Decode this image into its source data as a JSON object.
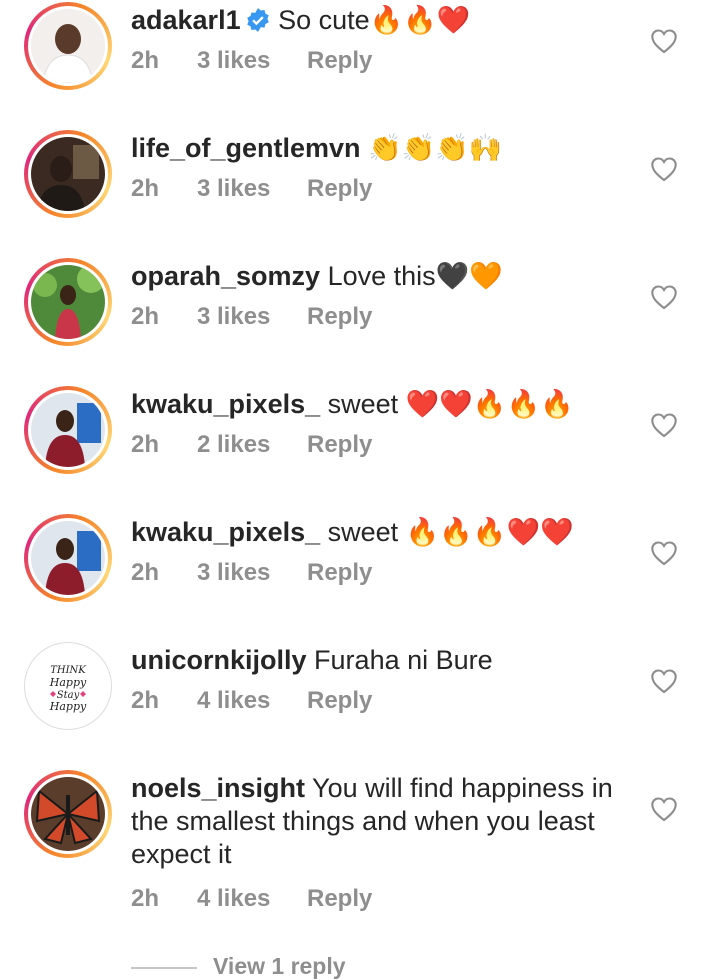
{
  "comments": [
    {
      "username": "adakarl1",
      "verified": true,
      "text": "So cute🔥🔥❤️",
      "time": "2h",
      "likes": "3 likes",
      "reply": "Reply"
    },
    {
      "username": "life_of_gentlemvn",
      "verified": false,
      "text": "👏👏👏🙌",
      "time": "2h",
      "likes": "3 likes",
      "reply": "Reply"
    },
    {
      "username": "oparah_somzy",
      "verified": false,
      "text": "Love this🖤🧡",
      "time": "2h",
      "likes": "3 likes",
      "reply": "Reply"
    },
    {
      "username": "kwaku_pixels_",
      "verified": false,
      "text": "sweet ❤️❤️🔥🔥🔥",
      "time": "2h",
      "likes": "2 likes",
      "reply": "Reply"
    },
    {
      "username": "kwaku_pixels_",
      "verified": false,
      "text": "sweet 🔥🔥🔥❤️❤️",
      "time": "2h",
      "likes": "3 likes",
      "reply": "Reply"
    },
    {
      "username": "unicornkijolly",
      "verified": false,
      "text": "Furaha  ni Bure",
      "time": "2h",
      "likes": "4 likes",
      "reply": "Reply",
      "avatar_text": [
        "THINK",
        "Happy",
        "Stay",
        "Happy"
      ]
    },
    {
      "username": "noels_insight",
      "verified": false,
      "text": "You will find happiness in the smallest things and when you least expect it",
      "time": "2h",
      "likes": "4 likes",
      "reply": "Reply"
    }
  ],
  "view_replies": "View 1 reply",
  "icons": {
    "like": "heart-outline-icon",
    "verified": "verified-badge-icon"
  },
  "colors": {
    "meta": "#8e8e8e",
    "verified": "#3897f0",
    "ring": "#dd2a7b"
  }
}
